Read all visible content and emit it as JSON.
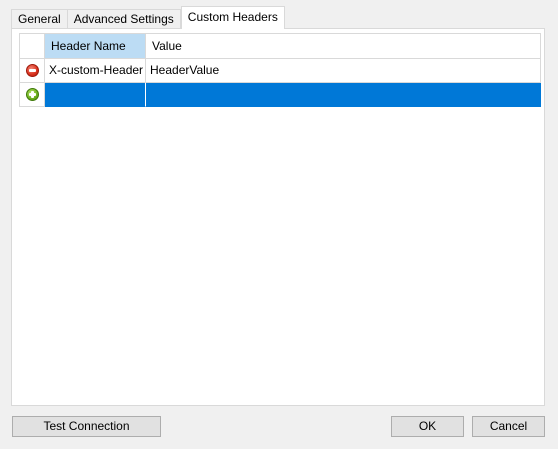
{
  "tabs": [
    {
      "label": "General",
      "active": false
    },
    {
      "label": "Advanced Settings",
      "active": false
    },
    {
      "label": "Custom Headers",
      "active": true
    }
  ],
  "grid": {
    "columns": [
      "Header Name",
      "Value"
    ],
    "rows": [
      {
        "icon": "remove-icon",
        "name": "X-custom-Header",
        "value": "HeaderValue"
      },
      {
        "icon": "add-icon",
        "name": "",
        "value": "",
        "selected": true
      }
    ]
  },
  "buttons": {
    "test_connection": "Test Connection",
    "ok": "OK",
    "cancel": "Cancel"
  },
  "colors": {
    "selection": "#0078d7",
    "header_highlight": "#bcdcf4"
  }
}
